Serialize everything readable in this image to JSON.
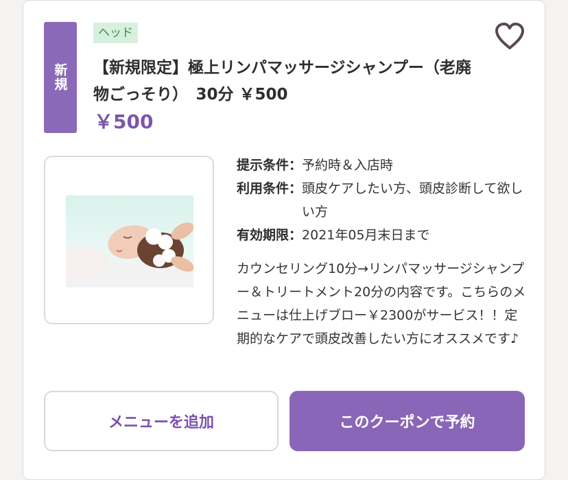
{
  "coupon": {
    "new_badge": "新規",
    "category": "ヘッド",
    "title": "【新規限定】極上リンパマッサージシャンプー（老廃物ごっそり）　30分 ￥500",
    "price": "￥500",
    "favorite_icon": "heart-outline-icon",
    "image_alt": "ヘッドスパ施術イメージ",
    "conditions": [
      {
        "label": "提示条件：",
        "value": "予約時＆入店時"
      },
      {
        "label": "利用条件：",
        "value": "頭皮ケアしたい方、頭皮診断して欲しい方"
      },
      {
        "label": "有効期限：",
        "value": "2021年05月末日まで"
      }
    ],
    "description": "カウンセリング10分→リンパマッサージシャンプー＆トリートメント20分の内容です。こちらのメニューは仕上げブロー￥2300がサービス！！定期的なケアで頭皮改善したい方にオススメです♪"
  },
  "actions": {
    "add_menu": "メニューを追加",
    "reserve": "このクーポンで予約"
  },
  "colors": {
    "accent": "#8a66b8",
    "price": "#7c55ad",
    "tag_bg": "#d7f0de",
    "tag_text": "#3b8c57"
  }
}
